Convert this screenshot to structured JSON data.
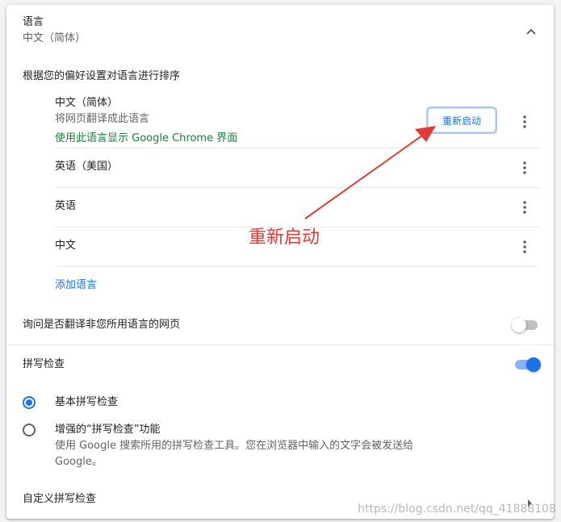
{
  "language_section": {
    "title": "语言",
    "current": "中文（简体）",
    "order_heading": "根据您的偏好设置对语言进行排序",
    "languages": [
      {
        "name": "中文（简体）",
        "subtitle": "将网页翻译成此语言",
        "ui_note": "使用此语言显示 Google Chrome 界面",
        "relaunch_label": "重新启动"
      },
      {
        "name": "英语（美国）"
      },
      {
        "name": "英语"
      },
      {
        "name": "中文"
      }
    ],
    "add_language_label": "添加语言",
    "offer_translate_label": "询问是否翻译非您所用语言的网页",
    "offer_translate_on": false
  },
  "spellcheck_section": {
    "title": "拼写检查",
    "enabled": true,
    "options": [
      {
        "label": "基本拼写检查",
        "selected": true
      },
      {
        "label": "增强的“拼写检查”功能",
        "description_line1": "使用 Google 搜索所用的拼写检查工具。您在浏览器中输入的文字会被发送给",
        "description_line2": "Google。",
        "selected": false
      }
    ],
    "customize_label": "自定义拼写检查"
  },
  "annotation": {
    "text": "重新启动",
    "color": "#e53935"
  },
  "watermark": "https://blog.csdn.net/qq_41888108",
  "colors": {
    "accent": "#1a73e8",
    "link_green": "#188038",
    "secondary_text": "#5f6368"
  },
  "icons": {
    "collapse": "chevron-up-icon",
    "more": "more-vert-icon",
    "submenu": "arrow-right-icon"
  }
}
